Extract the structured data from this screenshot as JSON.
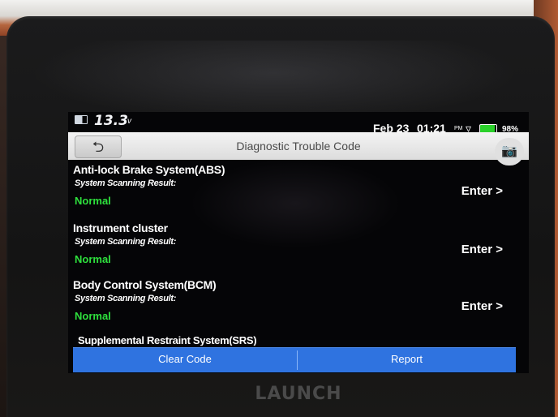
{
  "status_bar": {
    "voltage": "13.3",
    "voltage_unit": "v",
    "date": "Feb 23",
    "time": "01:21",
    "ampm": "PM",
    "battery_percent": "98%",
    "icons": [
      "battery-icon",
      "wifi-icon"
    ]
  },
  "header": {
    "back_symbol": "⮌",
    "title": "Diagnostic Trouble Code",
    "camera_symbol": "📷"
  },
  "results": [
    {
      "system": "Anti-lock Brake System(ABS)",
      "scan_label": "System Scanning Result:",
      "status": "Normal",
      "enter_label": "Enter >"
    },
    {
      "system": "Instrument cluster",
      "scan_label": "System Scanning Result:",
      "status": "Normal",
      "enter_label": "Enter >"
    },
    {
      "system": "Body Control System(BCM)",
      "scan_label": "System Scanning Result:",
      "status": "Normal",
      "enter_label": "Enter >"
    }
  ],
  "partial_item": "Supplemental Restraint System(SRS)",
  "actions": {
    "clear_code": "Clear Code",
    "report": "Report"
  },
  "device": {
    "brand": "LAUNCH"
  },
  "colors": {
    "status_ok": "#2ee03d",
    "action_bar": "#2f73e0",
    "title_bar": "#e6e6e6"
  }
}
